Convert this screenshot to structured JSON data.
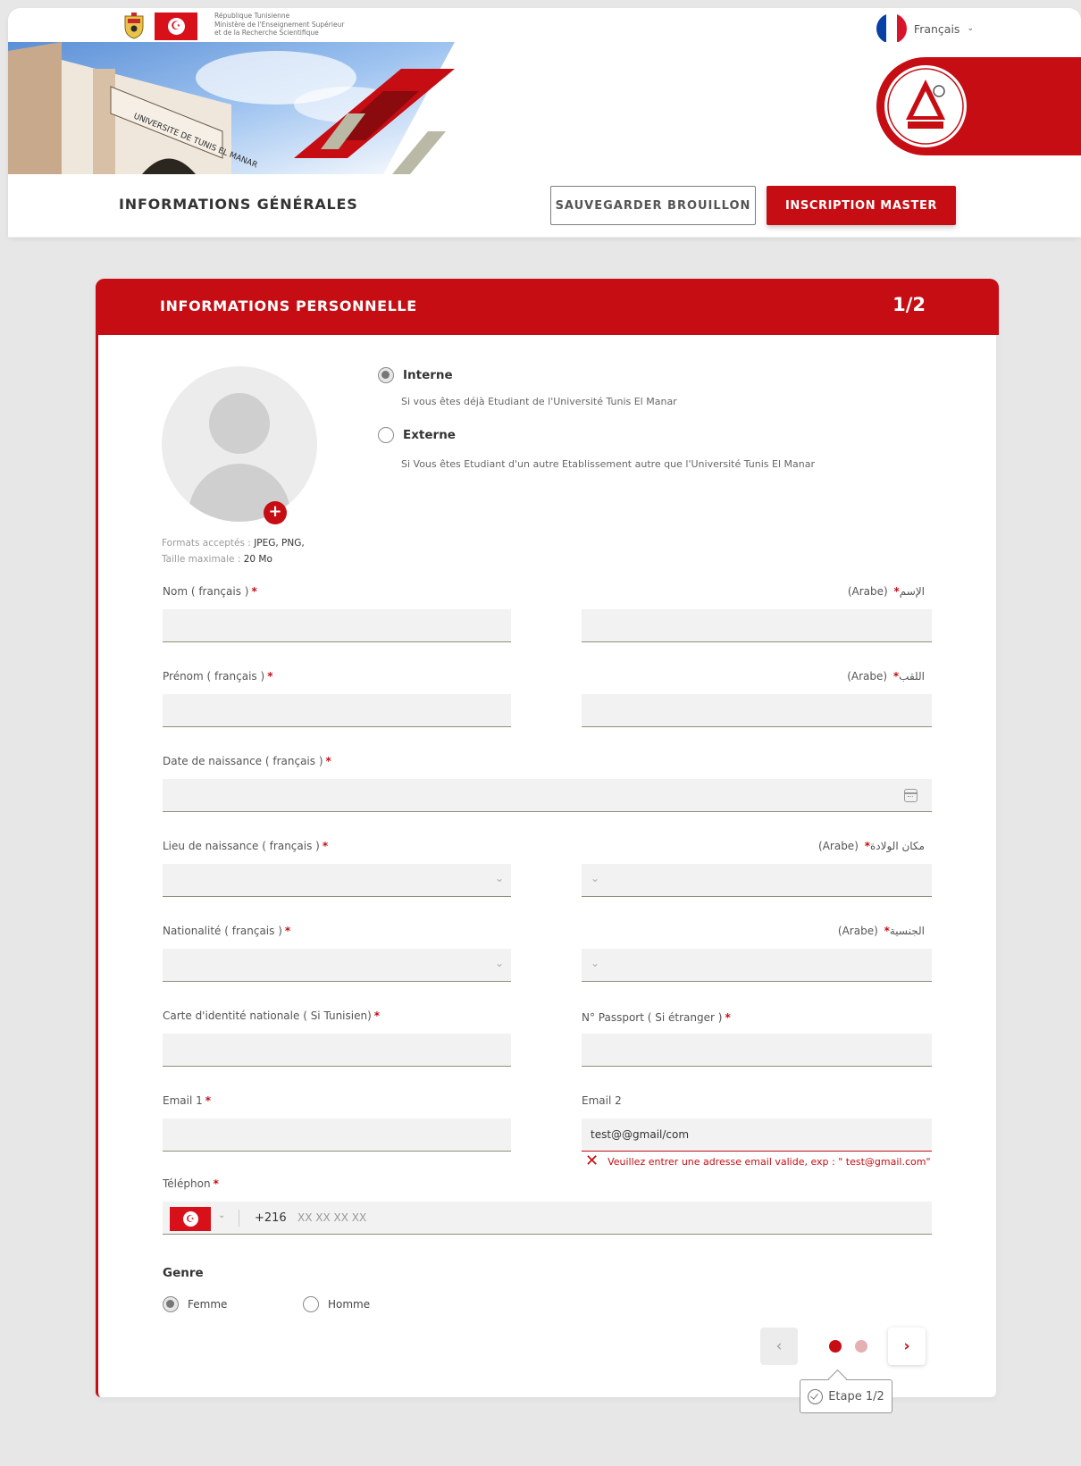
{
  "gov": {
    "line1": "République Tunisienne",
    "line2": "Ministère de l'Enseignement Supérieur",
    "line3": "et de la Recherche Scientifique"
  },
  "language": {
    "selected": "Français",
    "icon": "france-flag-icon"
  },
  "logo": {
    "alt": "جامعة تونس المنار"
  },
  "header": {
    "title": "INFORMATIONS GÉNÉRALES",
    "draft_button": "SAUVEGARDER BROUILLON",
    "master_button": "INSCRIPTION MASTER"
  },
  "card": {
    "title": "INFORMATIONS PERSONNELLE",
    "step": "1/2"
  },
  "photo": {
    "formats_label": "Formats acceptés : ",
    "formats_value": "JPEG, PNG,",
    "size_label": "Taille maximale : ",
    "size_value": "20 Mo"
  },
  "status": {
    "interne": {
      "label": "Interne",
      "desc": "Si vous êtes déjà Etudiant de l'Université Tunis El Manar",
      "selected": true
    },
    "externe": {
      "label": "Externe",
      "desc": "Si Vous êtes Etudiant d'un autre Etablissement autre que l'Université Tunis El Manar",
      "selected": false
    }
  },
  "fields": {
    "nom_fr": "Nom ( français )",
    "nom_ar": "(Arabe)",
    "nom_ar_word": "الإسم",
    "prenom_fr": "Prénom ( français )",
    "prenom_ar": "(Arabe)",
    "prenom_ar_word": "اللقب",
    "date_naissance": "Date de naissance ( français )",
    "lieu_fr": "Lieu de naissance ( français )",
    "lieu_ar": "(Arabe)",
    "lieu_ar_word": "مكان الولادة",
    "nat_fr": "Nationalité ( français )",
    "nat_ar": "(Arabe)",
    "nat_ar_word": "الجنسية",
    "cin": "Carte d'identité nationale ( Si Tunisien)",
    "passport": "N° Passport ( Si étranger )",
    "email1": "Email 1",
    "email2": "Email 2",
    "email2_value": "test@@gmail/com",
    "email2_error": "Veuillez entrer une adresse email valide, exp : \" test@gmail.com\"",
    "telephone": "Téléphon",
    "phone_code": "+216",
    "phone_placeholder": "XX XX XX XX",
    "required_mark": "*"
  },
  "genre": {
    "title": "Genre",
    "femme": {
      "label": "Femme",
      "selected": true
    },
    "homme": {
      "label": "Homme",
      "selected": false
    }
  },
  "pager": {
    "current_step": 1,
    "total_steps": 2,
    "tooltip": "Etape 1/2"
  },
  "colors": {
    "primary": "#c60d13",
    "background": "#e7e7e7",
    "field": "#f2f2f2"
  }
}
